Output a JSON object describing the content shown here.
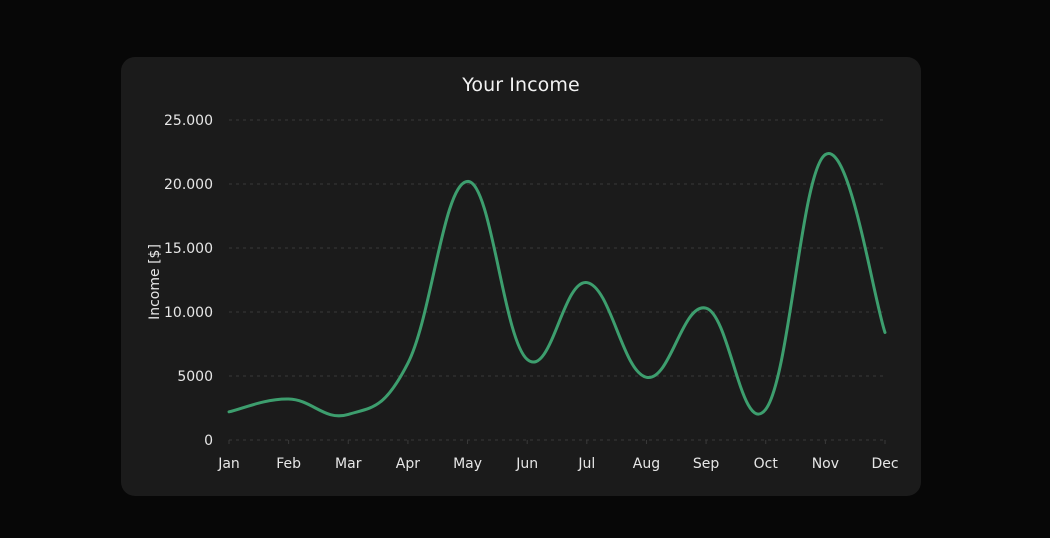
{
  "chart_data": {
    "type": "line",
    "title": "Your Income",
    "xlabel": "",
    "ylabel": "Income [$]",
    "categories": [
      "Jan",
      "Feb",
      "Mar",
      "Apr",
      "May",
      "Jun",
      "Jul",
      "Aug",
      "Sep",
      "Oct",
      "Nov",
      "Dec"
    ],
    "series": [
      {
        "values": [
          2200,
          3200,
          2000,
          6000,
          20200,
          6300,
          12300,
          4900,
          10300,
          2400,
          22300,
          8400
        ]
      }
    ],
    "ylim": [
      0,
      25000
    ],
    "yticks": [
      0,
      5000,
      10000,
      15000,
      20000,
      25000
    ],
    "ytick_labels": [
      "0",
      "5000",
      "10.000",
      "15.000",
      "20.000",
      "25.000"
    ],
    "grid": "horizontal dashed",
    "line_color": "#3d9e6e",
    "background_color": "#1b1b1b"
  }
}
